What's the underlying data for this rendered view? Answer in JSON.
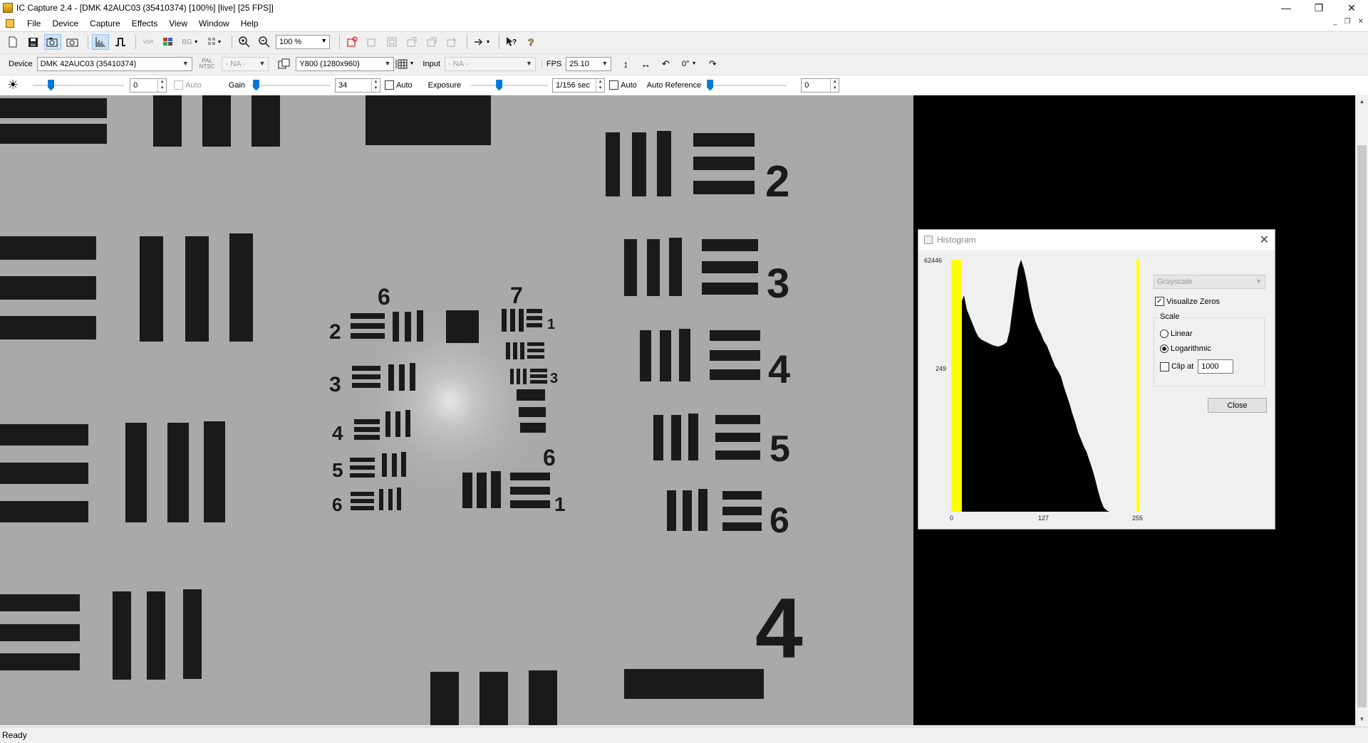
{
  "window": {
    "title": "IC Capture 2.4 - [DMK 42AUC03 (35410374) [100%]  [live]  [25 FPS]]",
    "minimize": "—",
    "restore": "❐",
    "close": "✕"
  },
  "menu": {
    "items": [
      "File",
      "Device",
      "Capture",
      "Effects",
      "View",
      "Window",
      "Help"
    ],
    "mdi_min": "_",
    "mdi_restore": "❐",
    "mdi_close": "✕"
  },
  "toolbar1": {
    "zoom_value": "100 %",
    "icons": [
      "new-icon",
      "save-icon",
      "live-camera-icon",
      "snapshot-camera-icon",
      "histogram-icon",
      "trigger-pulse-icon",
      "vdr-icon",
      "color-icon",
      "bg-icon",
      "grid-icon",
      "zoom-in-icon",
      "zoom-out-icon",
      "roi-icon",
      "overlay-1-icon",
      "overlay-2-icon",
      "overlay-3-icon",
      "overlay-4-icon",
      "overlay-5-icon",
      "share-icon",
      "context-help-icon",
      "help-icon"
    ],
    "labels": {
      "vdr": "VDR",
      "bg": "BG"
    }
  },
  "toolbar2": {
    "device_label": "Device",
    "device_value": "DMK 42AUC03 (35410374)",
    "pal": "PAL",
    "ntsc": "NTSC",
    "na_value": "- NA -",
    "format_value": "Y800 (1280x960)",
    "input_label": "Input",
    "input_value": "- NA -",
    "fps_label": "FPS",
    "fps_value": "25.10",
    "rotation_value": "0°"
  },
  "toolbar3": {
    "brightness_value": "0",
    "brightness_level": 0.18,
    "auto_label": "Auto",
    "gain_label": "Gain",
    "gain_value": "34",
    "gain_level": 0.03,
    "exposure_label": "Exposure",
    "exposure_value": "1/156 sec",
    "exposure_level": 0.35,
    "auto_reference_label": "Auto Reference",
    "auto_reference_value": "0",
    "auto_reference_level": 0.0
  },
  "status": {
    "text": "Ready"
  },
  "histogram": {
    "title": "Histogram",
    "close_x": "✕",
    "y_max": "62446",
    "y_mid": "249",
    "x_min": "0",
    "x_mid": "127",
    "x_max": "255",
    "mode_value": "Grayscale",
    "visualize_zeros_label": "Visualize Zeros",
    "visualize_zeros_checked": true,
    "scale_label": "Scale",
    "linear_label": "Linear",
    "logarithmic_label": "Logarithmic",
    "log_selected": true,
    "clip_label": "Clip at",
    "clip_value": "1000",
    "close_button": "Close",
    "colors": {
      "marker": "#ffff00",
      "bars": "#000000"
    }
  },
  "target": {
    "labels": [
      "2",
      "3",
      "4",
      "5",
      "6",
      "6",
      "7",
      "1",
      "3",
      "6",
      "1",
      "2",
      "3",
      "4",
      "5",
      "6",
      "4"
    ]
  }
}
